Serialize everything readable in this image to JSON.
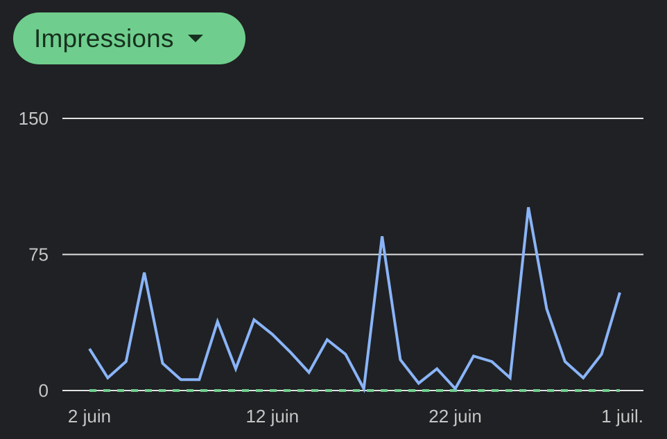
{
  "metric_selector": {
    "label": "Impressions",
    "icon": "caret-down-icon"
  },
  "colors": {
    "background": "#1f2124",
    "chip": "#6fce8d",
    "chip_text": "#17301f",
    "series_line": "#8ab4f8",
    "baseline_dash": "#6fce8d",
    "gridline": "#e3e3e3",
    "tick_text": "#c4c7c5"
  },
  "chart_data": {
    "type": "line",
    "title": "",
    "xlabel": "",
    "ylabel": "",
    "ylim": [
      0,
      150
    ],
    "yticks": [
      0,
      75,
      150
    ],
    "ytick_labels": [
      "0",
      "75",
      "150"
    ],
    "x": [
      "2 juin",
      "3 juin",
      "4 juin",
      "5 juin",
      "6 juin",
      "7 juin",
      "8 juin",
      "9 juin",
      "10 juin",
      "11 juin",
      "12 juin",
      "13 juin",
      "14 juin",
      "15 juin",
      "16 juin",
      "17 juin",
      "18 juin",
      "19 juin",
      "20 juin",
      "21 juin",
      "22 juin",
      "23 juin",
      "24 juin",
      "25 juin",
      "26 juin",
      "27 juin",
      "28 juin",
      "29 juin",
      "30 juin",
      "1 juil."
    ],
    "xtick_labels": [
      {
        "index": 0,
        "label": "2 juin"
      },
      {
        "index": 10,
        "label": "12 juin"
      },
      {
        "index": 20,
        "label": "22 juin"
      },
      {
        "index": 29,
        "label": "1 juil."
      }
    ],
    "grid": true,
    "series": [
      {
        "style": "solid",
        "color": "#8ab4f8",
        "values": [
          23,
          7,
          16,
          65,
          15,
          6,
          6,
          38,
          12,
          39,
          31,
          21,
          10,
          28,
          20,
          1,
          85,
          17,
          4,
          12,
          1,
          19,
          16,
          7,
          101,
          45,
          16,
          7,
          20,
          54
        ]
      },
      {
        "style": "dashed",
        "color": "#6fce8d",
        "values": [
          0,
          0,
          0,
          0,
          0,
          0,
          0,
          0,
          0,
          0,
          0,
          0,
          0,
          0,
          0,
          0,
          0,
          0,
          0,
          0,
          0,
          0,
          0,
          0,
          0,
          0,
          0,
          0,
          0,
          0
        ]
      }
    ]
  }
}
